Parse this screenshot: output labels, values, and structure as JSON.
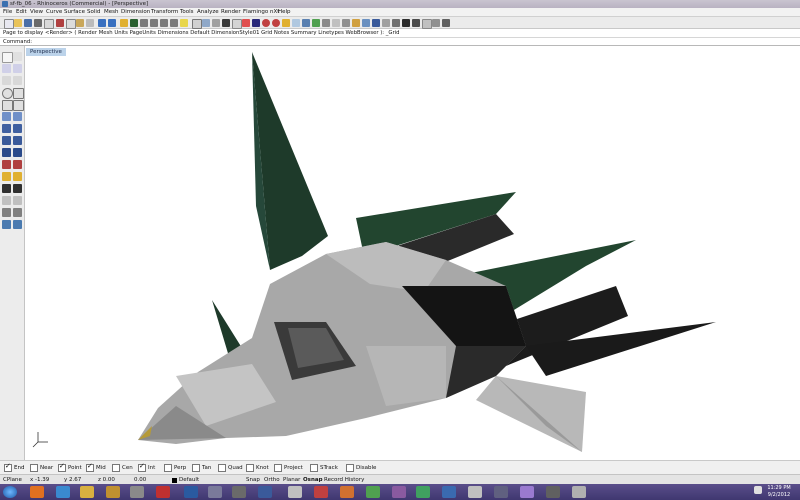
{
  "window": {
    "title": "sf-fb_06 - Rhinoceros (Commercial) - [Perspective]"
  },
  "menu": [
    "File",
    "Edit",
    "View",
    "Curve",
    "Surface",
    "Solid",
    "Mesh",
    "Dimension",
    "Transform",
    "Tools",
    "Analyze",
    "Render",
    "Flamingo nXt",
    "Help"
  ],
  "command_history": "Page to display <Render> ( Render Mesh Units PageUnits Dimensions Default DimensionStyle01 Grid Notes Summary Linetypes WebBrowser ): _Grid",
  "command_prompt": "Command:",
  "viewport": {
    "name": "Perspective"
  },
  "osnap": [
    {
      "label": "End",
      "checked": true
    },
    {
      "label": "Near",
      "checked": false
    },
    {
      "label": "Point",
      "checked": true
    },
    {
      "label": "Mid",
      "checked": true
    },
    {
      "label": "Cen",
      "checked": false
    },
    {
      "label": "Int",
      "checked": true
    },
    {
      "label": "Perp",
      "checked": false
    },
    {
      "label": "Tan",
      "checked": false
    },
    {
      "label": "Quad",
      "checked": false
    },
    {
      "label": "Knot",
      "checked": false
    },
    {
      "label": "Project",
      "checked": false
    },
    {
      "label": "STrack",
      "checked": false
    },
    {
      "label": "Disable",
      "checked": false
    }
  ],
  "status": {
    "cplane": "CPlane",
    "x": "x -1.39",
    "y": "y 2.67",
    "z": "z 0.00",
    "extra": "0.00",
    "layer": "Default",
    "snap": "Snap",
    "ortho": "Ortho",
    "planar": "Planar",
    "osnap": "Osnap",
    "record_history": "Record History"
  },
  "clock": {
    "time": "11:29 PM",
    "date": "9/2/2012"
  },
  "colors": {
    "taskbar": "#4a3f7c",
    "viewport_tab": "#bcd3ea",
    "hull_gray": "#a9a9a9",
    "hull_green": "#1f3d2c"
  }
}
